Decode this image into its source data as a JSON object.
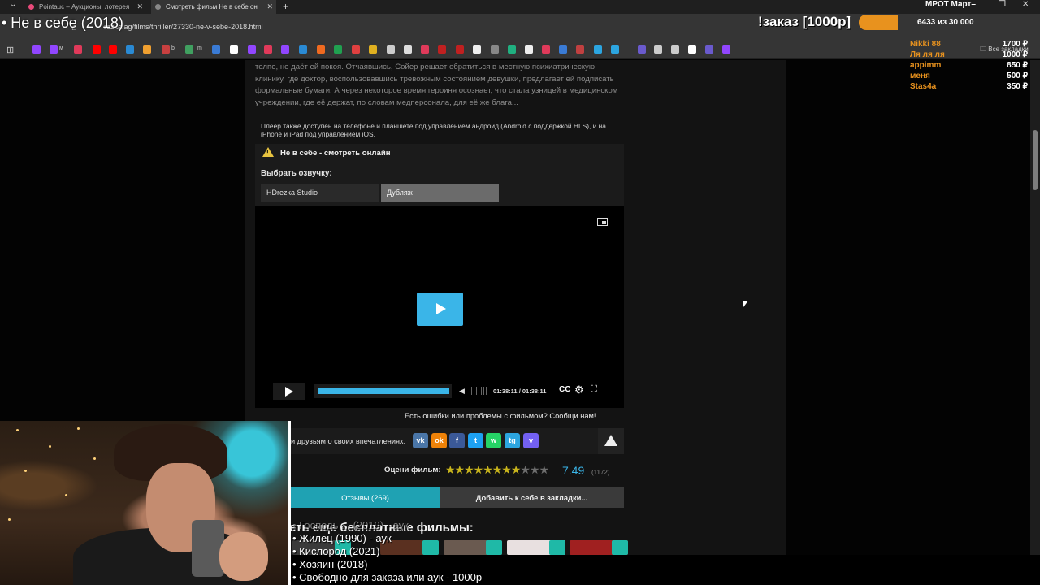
{
  "browser": {
    "tabs": [
      {
        "title": "Pointauc – Аукционы, лотерея",
        "active": false
      },
      {
        "title": "Смотреть фильм Не в себе он",
        "active": true
      }
    ],
    "url": "rezka.ag/films/thriller/27330-ne-v-sebe-2018.html",
    "bookmark_labels": [
      "м",
      "b",
      "m"
    ],
    "all_bookmarks": "Все закладки"
  },
  "overlay": {
    "title": "• Не в себе (2018)",
    "order_text": "!заказ [1000р]",
    "order_count": "6433  из 30 000",
    "mrot": "МРОТ Март–",
    "donors": [
      {
        "name": "Nikki 88",
        "amount": "1700 ₽",
        "color": "#e8921e"
      },
      {
        "name": "Ля ля ля",
        "amount": "1000 ₽",
        "color": "#e8921e"
      },
      {
        "name": "appimm",
        "amount": "850 ₽",
        "color": "#e8921e"
      },
      {
        "name": "меня",
        "amount": "500 ₽",
        "color": "#e8921e"
      },
      {
        "name": "Stas4a",
        "amount": "350 ₽",
        "color": "#e8921e"
      }
    ],
    "order_list": [
      "• Жилец (1990) - аук",
      "• Кислород (2021)",
      "• Хозяин (2018)",
      "• Свободно для заказа или аук - 1000р"
    ],
    "order_list_faded": "• Господь ... (2019) - аук"
  },
  "page": {
    "description": "толпе, не даёт ей покоя. Отчаявшись, Сойер решает обратиться в местную психиатрическую клинику, где доктор, воспользовавшись тревожным состоянием девушки, предлагает ей подписать формальные бумаги. А через некоторое время героиня осознает, что стала узницей в медицинском учреждении, где её держат, по словам медперсонала, для её же блага...",
    "player_note": "Плеер также доступен на телефоне и планшете под управлением андроид (Android с поддержкой HLS), и на iPhone и iPad под управлением iOS.",
    "warn_title": "Не в себе - смотреть онлайн",
    "voice_label": "Выбрать озвучку:",
    "voices": [
      "HDrezka Studio",
      "Дубляж"
    ],
    "player": {
      "timecode": "01:38:11 / 01:38:11",
      "cc": "CC",
      "progress": 1.0
    },
    "report": "Есть ошибки или проблемы с фильмом? Сообщи нам!",
    "share_label": "и друзьям о своих впечатлениях:",
    "social": [
      {
        "label": "vk",
        "color": "#4a76a8"
      },
      {
        "label": "ok",
        "color": "#ee8208"
      },
      {
        "label": "f",
        "color": "#3b5998"
      },
      {
        "label": "t",
        "color": "#1da1f2"
      },
      {
        "label": "w",
        "color": "#25d366"
      },
      {
        "label": "tg",
        "color": "#2ca5e0"
      },
      {
        "label": "v",
        "color": "#7360f2"
      }
    ],
    "rating_label": "Оцени фильм:",
    "rating_score": "7.49",
    "rating_votes": "(1172)",
    "stars_full": "★★★★★★★★",
    "stars_empty": "★★★",
    "reviews_button": "Отзывы (269)",
    "bookmark_button": "Добавить к себе в закладки...",
    "more_heading": "еть еще бесплатные фильмы:"
  }
}
